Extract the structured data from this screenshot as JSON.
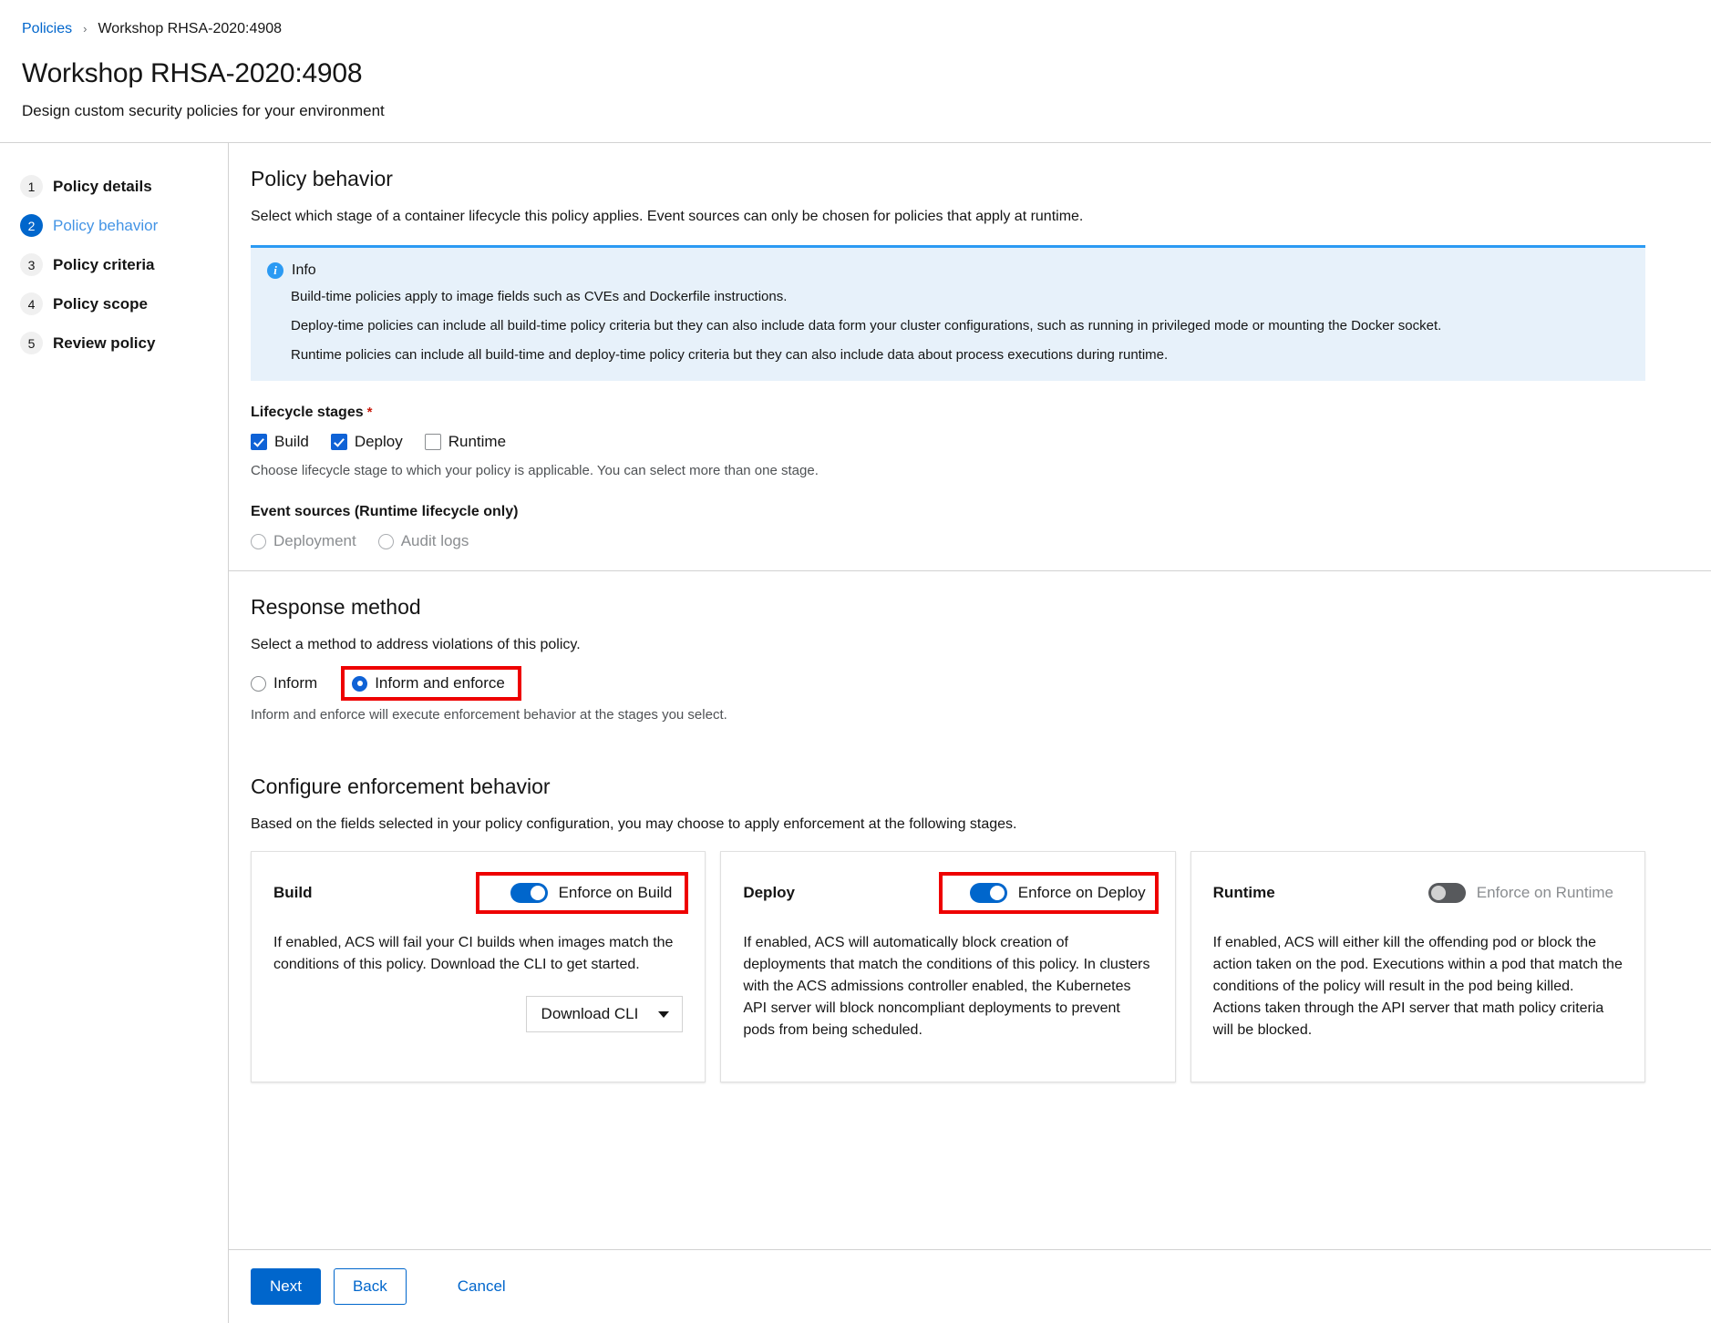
{
  "breadcrumb": {
    "root_label": "Policies",
    "separator": "›",
    "current_label": "Workshop RHSA-2020:4908"
  },
  "header": {
    "title": "Workshop RHSA-2020:4908",
    "subtitle": "Design custom security policies for your environment"
  },
  "wizard_nav": {
    "steps": [
      {
        "number": "1",
        "label": "Policy details"
      },
      {
        "number": "2",
        "label": "Policy behavior"
      },
      {
        "number": "3",
        "label": "Policy criteria"
      },
      {
        "number": "4",
        "label": "Policy scope"
      },
      {
        "number": "5",
        "label": "Review policy"
      }
    ]
  },
  "policy_behavior": {
    "title": "Policy behavior",
    "description": "Select which stage of a container lifecycle this policy applies. Event sources can only be chosen for policies that apply at runtime.",
    "info_alert": {
      "icon": "info-circle-icon",
      "title": "Info",
      "lines": [
        "Build-time policies apply to image fields such as CVEs and Dockerfile instructions.",
        "Deploy-time policies can include all build-time policy criteria but they can also include data form your cluster configurations, such as running in privileged mode or mounting the Docker socket.",
        "Runtime policies can include all build-time and deploy-time policy criteria but they can also include data about process executions during runtime."
      ]
    },
    "lifecycle_stages": {
      "label": "Lifecycle stages",
      "required_marker": "*",
      "options": [
        {
          "label": "Build",
          "checked": true
        },
        {
          "label": "Deploy",
          "checked": true
        },
        {
          "label": "Runtime",
          "checked": false
        }
      ],
      "helper": "Choose lifecycle stage to which your policy is applicable. You can select more than one stage."
    },
    "event_sources": {
      "label": "Event sources (Runtime lifecycle only)",
      "options": [
        {
          "label": "Deployment",
          "selected": false,
          "disabled": true
        },
        {
          "label": "Audit logs",
          "selected": false,
          "disabled": true
        }
      ]
    }
  },
  "response_method": {
    "title": "Response method",
    "description": "Select a method to address violations of this policy.",
    "options": [
      {
        "label": "Inform",
        "selected": false
      },
      {
        "label": "Inform and enforce",
        "selected": true,
        "highlighted": true
      }
    ],
    "helper": "Inform and enforce will execute enforcement behavior at the stages you select."
  },
  "enforcement": {
    "title": "Configure enforcement behavior",
    "description": "Based on the fields selected in your policy configuration, you may choose to apply enforcement at the following stages.",
    "cards": [
      {
        "title": "Build",
        "toggle_label": "Enforce on Build",
        "toggle_on": true,
        "toggle_disabled": false,
        "highlighted": true,
        "body": "If enabled, ACS will fail your CI builds when images match the conditions of this policy. Download the CLI to get started.",
        "dropdown_label": "Download CLI"
      },
      {
        "title": "Deploy",
        "toggle_label": "Enforce on Deploy",
        "toggle_on": true,
        "toggle_disabled": false,
        "highlighted": true,
        "body": "If enabled, ACS will automatically block creation of deployments that match the conditions of this policy. In clusters with the ACS admissions controller enabled, the Kubernetes API server will block noncompliant deployments to prevent pods from being scheduled."
      },
      {
        "title": "Runtime",
        "toggle_label": "Enforce on Runtime",
        "toggle_on": false,
        "toggle_disabled": true,
        "highlighted": false,
        "body": "If enabled, ACS will either kill the offending pod or block the action taken on the pod. Executions within a pod that match the conditions of the policy will result in the pod being killed. Actions taken through the API server that math policy criteria will be blocked."
      }
    ]
  },
  "footer": {
    "next_label": "Next",
    "back_label": "Back",
    "cancel_label": "Cancel"
  },
  "colors": {
    "accent_blue": "#0066cc",
    "checkbox_blue": "#0f62d6",
    "info_blue": "#2b9af3",
    "info_bg": "#e7f1fa",
    "annotation_red": "#ee0000",
    "toggle_off_gray": "#57595c"
  }
}
